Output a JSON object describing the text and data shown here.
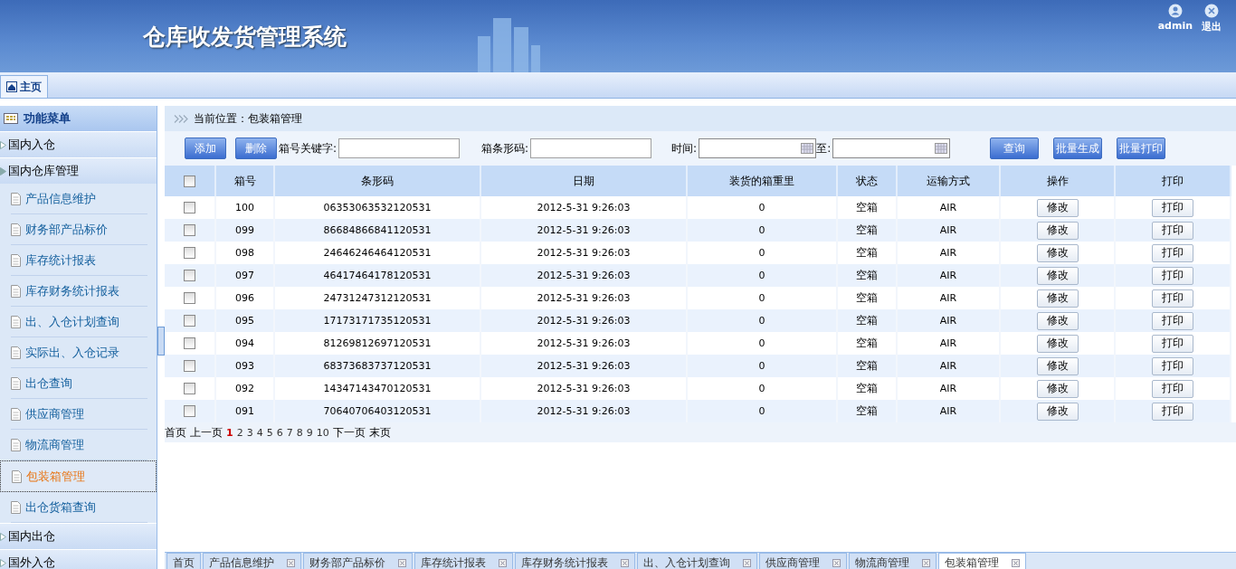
{
  "header": {
    "title": "仓库收发货管理系统",
    "user": "admin",
    "logout": "退出"
  },
  "top_tabs": [
    {
      "label": "主页",
      "selected": true
    }
  ],
  "sidebar": {
    "title": "功能菜单",
    "groups": [
      {
        "label": "国内入仓",
        "expanded": false
      },
      {
        "label": "国内仓库管理",
        "expanded": true,
        "children": [
          {
            "label": "产品信息维护",
            "selected": false
          },
          {
            "label": "财务部产品标价",
            "selected": false
          },
          {
            "label": "库存统计报表",
            "selected": false
          },
          {
            "label": "库存财务统计报表",
            "selected": false
          },
          {
            "label": "出、入仓计划查询",
            "selected": false
          },
          {
            "label": "实际出、入仓记录",
            "selected": false
          },
          {
            "label": "出仓查询",
            "selected": false
          },
          {
            "label": "供应商管理",
            "selected": false
          },
          {
            "label": "物流商管理",
            "selected": false
          },
          {
            "label": "包装箱管理",
            "selected": true
          },
          {
            "label": "出仓货箱查询",
            "selected": false
          }
        ]
      },
      {
        "label": "国内出仓",
        "expanded": false
      },
      {
        "label": "国外入仓",
        "expanded": false
      }
    ]
  },
  "breadcrumb": "当前位置：包装箱管理",
  "toolbar": {
    "add": "添加",
    "delete": "删除",
    "keyword_label": "箱号关键字:",
    "barcode_label": "箱条形码:",
    "time_label": "时间:",
    "to_label": "至:",
    "query": "查询",
    "batch_generate": "批量生成",
    "batch_print": "批量打印"
  },
  "table": {
    "columns": [
      "箱号",
      "条形码",
      "日期",
      "装货的箱重里",
      "状态",
      "运输方式",
      "操作",
      "打印"
    ],
    "header_checked": false,
    "rows": [
      {
        "checked": false,
        "cells": [
          "100",
          "06353063532120531",
          "2012-5-31 9:26:03",
          "0",
          "空箱",
          "AIR"
        ],
        "edit": "修改",
        "print": "打印"
      },
      {
        "checked": false,
        "cells": [
          "099",
          "86684866841120531",
          "2012-5-31 9:26:03",
          "0",
          "空箱",
          "AIR"
        ],
        "edit": "修改",
        "print": "打印"
      },
      {
        "checked": false,
        "cells": [
          "098",
          "24646246464120531",
          "2012-5-31 9:26:03",
          "0",
          "空箱",
          "AIR"
        ],
        "edit": "修改",
        "print": "打印"
      },
      {
        "checked": false,
        "cells": [
          "097",
          "46417464178120531",
          "2012-5-31 9:26:03",
          "0",
          "空箱",
          "AIR"
        ],
        "edit": "修改",
        "print": "打印"
      },
      {
        "checked": false,
        "cells": [
          "096",
          "24731247312120531",
          "2012-5-31 9:26:03",
          "0",
          "空箱",
          "AIR"
        ],
        "edit": "修改",
        "print": "打印"
      },
      {
        "checked": false,
        "cells": [
          "095",
          "17173171735120531",
          "2012-5-31 9:26:03",
          "0",
          "空箱",
          "AIR"
        ],
        "edit": "修改",
        "print": "打印"
      },
      {
        "checked": false,
        "cells": [
          "094",
          "81269812697120531",
          "2012-5-31 9:26:03",
          "0",
          "空箱",
          "AIR"
        ],
        "edit": "修改",
        "print": "打印"
      },
      {
        "checked": false,
        "cells": [
          "093",
          "68373683737120531",
          "2012-5-31 9:26:03",
          "0",
          "空箱",
          "AIR"
        ],
        "edit": "修改",
        "print": "打印"
      },
      {
        "checked": false,
        "cells": [
          "092",
          "14347143470120531",
          "2012-5-31 9:26:03",
          "0",
          "空箱",
          "AIR"
        ],
        "edit": "修改",
        "print": "打印"
      },
      {
        "checked": false,
        "cells": [
          "091",
          "70640706403120531",
          "2012-5-31 9:26:03",
          "0",
          "空箱",
          "AIR"
        ],
        "edit": "修改",
        "print": "打印"
      }
    ]
  },
  "pagination": {
    "first": "首页",
    "prev": "上一页",
    "pages": [
      {
        "label": "1",
        "selected": true
      },
      {
        "label": "2",
        "selected": false
      },
      {
        "label": "3",
        "selected": false
      },
      {
        "label": "4",
        "selected": false
      },
      {
        "label": "5",
        "selected": false
      },
      {
        "label": "6",
        "selected": false
      },
      {
        "label": "7",
        "selected": false
      },
      {
        "label": "8",
        "selected": false
      },
      {
        "label": "9",
        "selected": false
      },
      {
        "label": "10",
        "selected": false
      }
    ],
    "next": "下一页",
    "last": "末页"
  },
  "bottom_tabs": [
    {
      "label": "首页",
      "closable": false,
      "selected": false
    },
    {
      "label": "产品信息维护",
      "closable": true,
      "selected": false
    },
    {
      "label": "财务部产品标价",
      "closable": true,
      "selected": false
    },
    {
      "label": "库存统计报表",
      "closable": true,
      "selected": false
    },
    {
      "label": "库存财务统计报表",
      "closable": true,
      "selected": false
    },
    {
      "label": "出、入仓计划查询",
      "closable": true,
      "selected": false
    },
    {
      "label": "供应商管理",
      "closable": true,
      "selected": false
    },
    {
      "label": "物流商管理",
      "closable": true,
      "selected": false
    },
    {
      "label": "包装箱管理",
      "closable": true,
      "selected": true
    }
  ]
}
